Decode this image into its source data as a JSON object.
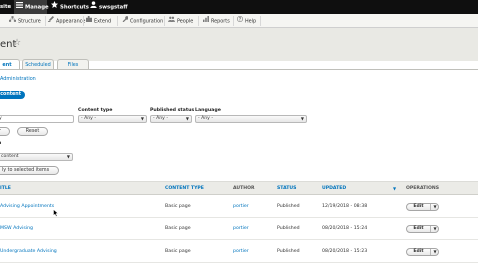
{
  "toolbar": {
    "site_label": "site",
    "manage_label": "Manage",
    "shortcuts_label": "Shortcuts",
    "user_label": "swsgstaff"
  },
  "tray": {
    "items": [
      {
        "label": "Structure",
        "icon": "structure-icon"
      },
      {
        "label": "Appearance",
        "icon": "appearance-icon"
      },
      {
        "label": "Extend",
        "icon": "extend-icon"
      },
      {
        "label": "Configuration",
        "icon": "configuration-icon"
      },
      {
        "label": "People",
        "icon": "people-icon"
      },
      {
        "label": "Reports",
        "icon": "reports-icon"
      },
      {
        "label": "Help",
        "icon": "help-icon"
      }
    ]
  },
  "page": {
    "title": "ent",
    "tabs": [
      "ent",
      "Scheduled",
      "Files"
    ],
    "breadcrumb": "Administration",
    "add_button": "content"
  },
  "filters": {
    "title_value": "y",
    "content_type_label": "Content type",
    "content_type_value": "- Any -",
    "status_label": "Published status",
    "status_value": "- Any -",
    "language_label": "Language",
    "language_value": "- Any -",
    "filter_button": "r",
    "reset_button": "Reset"
  },
  "bulk": {
    "action_label": "n",
    "action_value": "content",
    "apply_button": "ly to selected items"
  },
  "table": {
    "headers": {
      "title": "ITLE",
      "content_type": "CONTENT TYPE",
      "author": "AUTHOR",
      "status": "STATUS",
      "updated": "UPDATED",
      "operations": "OPERATIONS"
    },
    "rows": [
      {
        "title": "Advising Appointments",
        "type": "Basic page",
        "author": "portier",
        "status": "Published",
        "updated": "12/19/2018 - 08:38",
        "op": "Edit"
      },
      {
        "title": "MSW Advising",
        "type": "Basic page",
        "author": "portier",
        "status": "Published",
        "updated": "08/20/2018 - 15:24",
        "op": "Edit"
      },
      {
        "title": "Undergraduate Advising",
        "type": "Basic page",
        "author": "portier",
        "status": "Published",
        "updated": "08/20/2018 - 15:23",
        "op": "Edit"
      }
    ]
  },
  "colors": {
    "toolbar_bg": "#0f0f0f",
    "link": "#0074bd",
    "header_bg": "#e9e9e4",
    "primary_button": "#0074bd"
  }
}
